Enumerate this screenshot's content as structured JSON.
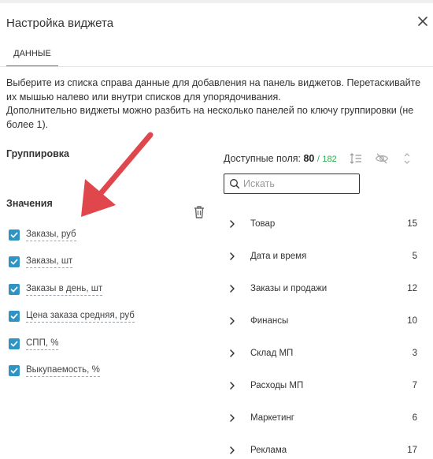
{
  "dialog": {
    "title": "Настройка виджета",
    "tab_data": "ДАННЫЕ",
    "description_line1": "Выберите из списка справа данные для добавления на панель виджетов. Перетаскивайте их мышью налево или внутри списков для упорядочивания.",
    "description_line2": "Дополнительно виджеты можно разбить на несколько панелей по ключу группировки (не более 1)."
  },
  "grouping": {
    "label": "Группировка"
  },
  "values": {
    "label": "Значения",
    "items": [
      {
        "label": "Заказы, руб",
        "checked": true
      },
      {
        "label": "Заказы, шт",
        "checked": true
      },
      {
        "label": "Заказы в день, шт",
        "checked": true
      },
      {
        "label": "Цена заказа средняя, руб",
        "checked": true
      },
      {
        "label": "СПП, %",
        "checked": true
      },
      {
        "label": "Выкупаемость, %",
        "checked": true
      }
    ]
  },
  "available": {
    "label": "Доступные поля:",
    "count": "80",
    "separator": "/",
    "total": "182"
  },
  "search": {
    "placeholder": "Искать",
    "value": ""
  },
  "fields": [
    {
      "name": "Товар",
      "count": "15"
    },
    {
      "name": "Дата и время",
      "count": "5"
    },
    {
      "name": "Заказы и продажи",
      "count": "12"
    },
    {
      "name": "Финансы",
      "count": "10"
    },
    {
      "name": "Склад МП",
      "count": "3"
    },
    {
      "name": "Расходы МП",
      "count": "7"
    },
    {
      "name": "Маркетинг",
      "count": "6"
    },
    {
      "name": "Реклама",
      "count": "17"
    }
  ],
  "colors": {
    "accent": "#2f93c4",
    "total_green": "#2fa84f",
    "annotation_arrow": "#e0474c"
  },
  "icons": {
    "close": "close-icon",
    "trash": "trash-icon",
    "sort": "sort-icon",
    "visibility": "eye-off-icon",
    "expand": "expand-collapse-icon",
    "search": "search-icon",
    "chevron": "chevron-right-icon",
    "check": "check-icon"
  }
}
